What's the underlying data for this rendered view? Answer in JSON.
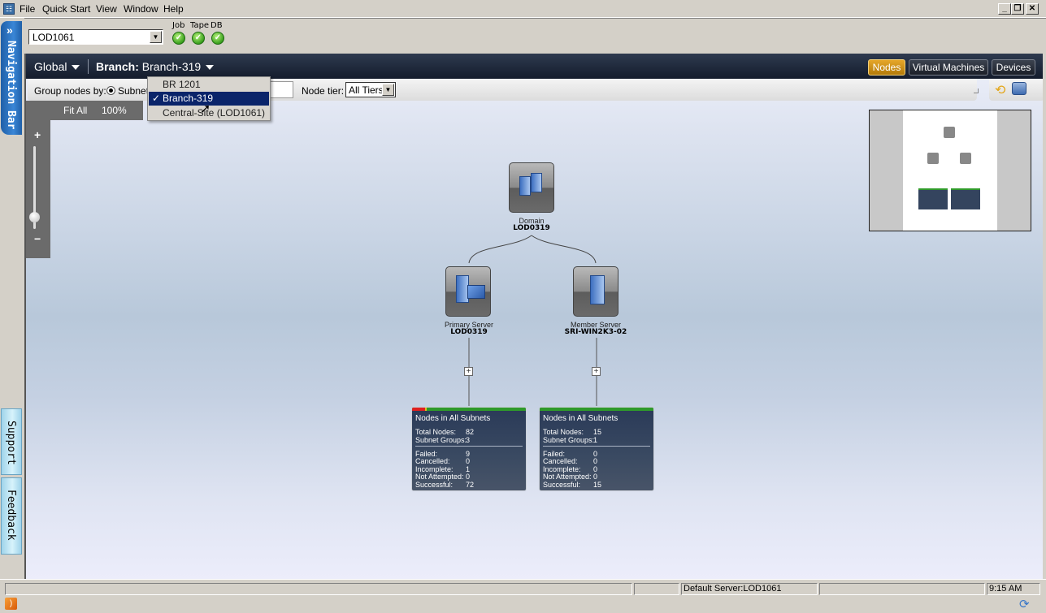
{
  "menu": {
    "items": [
      "File",
      "Quick Start",
      "View",
      "Window",
      "Help"
    ],
    "underline": [
      "F",
      "Q",
      "V",
      "W",
      "H"
    ]
  },
  "window_controls": {
    "minimize": "_",
    "restore": "❐",
    "close": "✕"
  },
  "toolbar": {
    "server_value": "LOD1061",
    "status_indicators": [
      {
        "label": "Job",
        "state": "ok"
      },
      {
        "label": "Tape",
        "state": "ok"
      },
      {
        "label": "DB",
        "state": "ok"
      }
    ]
  },
  "side_tabs": {
    "navigation": "Navigation Bar",
    "navigation_icon": "»",
    "support": "Support",
    "feedback": "Feedback"
  },
  "header": {
    "global_label": "Global",
    "branch_prefix": "Branch:",
    "branch_value": "Branch-319",
    "views": [
      {
        "label": "Nodes",
        "active": true
      },
      {
        "label": "Virtual Machines",
        "active": false
      },
      {
        "label": "Devices",
        "active": false
      }
    ]
  },
  "branch_dropdown": {
    "options": [
      {
        "label": "BR 1201",
        "selected": false
      },
      {
        "label": "Branch-319",
        "selected": true
      },
      {
        "label": "Central-Site (LOD1061)",
        "selected": false
      }
    ],
    "check_mark": "✓"
  },
  "filter": {
    "group_by_label": "Group nodes by:",
    "group_by_value": "Subnet",
    "node_tier_label": "Node tier:",
    "node_tier_value": "All Tiers"
  },
  "zoom": {
    "fit_all": "Fit All",
    "level": "100%",
    "plus": "+",
    "minus": "−",
    "slider_fraction": 0.15
  },
  "topology": {
    "domain": {
      "caption": "Domain",
      "name": "LOD0319"
    },
    "servers": [
      {
        "caption": "Primary Server",
        "name": "LOD0319",
        "summary": {
          "title": "Nodes in All Subnets",
          "total_nodes_label": "Total Nodes:",
          "total_nodes": "82",
          "subnet_groups_label": "Subnet Groups:",
          "subnet_groups": "3",
          "stats": [
            {
              "label": "Failed:",
              "value": "9"
            },
            {
              "label": "Cancelled:",
              "value": "0"
            },
            {
              "label": "Incomplete:",
              "value": "1"
            },
            {
              "label": "Not Attempted:",
              "value": "0"
            },
            {
              "label": "Successful:",
              "value": "72"
            }
          ],
          "bar": {
            "failed_fraction": 0.11,
            "incomplete_fraction": 0.012
          }
        }
      },
      {
        "caption": "Member Server",
        "name": "SRI-WIN2K3-02",
        "summary": {
          "title": "Nodes in All Subnets",
          "total_nodes_label": "Total Nodes:",
          "total_nodes": "15",
          "subnet_groups_label": "Subnet Groups:",
          "subnet_groups": "1",
          "stats": [
            {
              "label": "Failed:",
              "value": "0"
            },
            {
              "label": "Cancelled:",
              "value": "0"
            },
            {
              "label": "Incomplete:",
              "value": "0"
            },
            {
              "label": "Not Attempted:",
              "value": "0"
            },
            {
              "label": "Successful:",
              "value": "15"
            }
          ],
          "bar": {
            "failed_fraction": 0,
            "incomplete_fraction": 0
          }
        }
      }
    ],
    "expand_symbol": "+"
  },
  "statusbar": {
    "default_server": "Default Server:LOD1061",
    "time": "9:15 AM"
  },
  "colors": {
    "active_view": "#d99a1a",
    "success": "#2f9a2a",
    "failed": "#e02020",
    "incomplete": "#e0c020",
    "selected_item": "#0a246a"
  }
}
